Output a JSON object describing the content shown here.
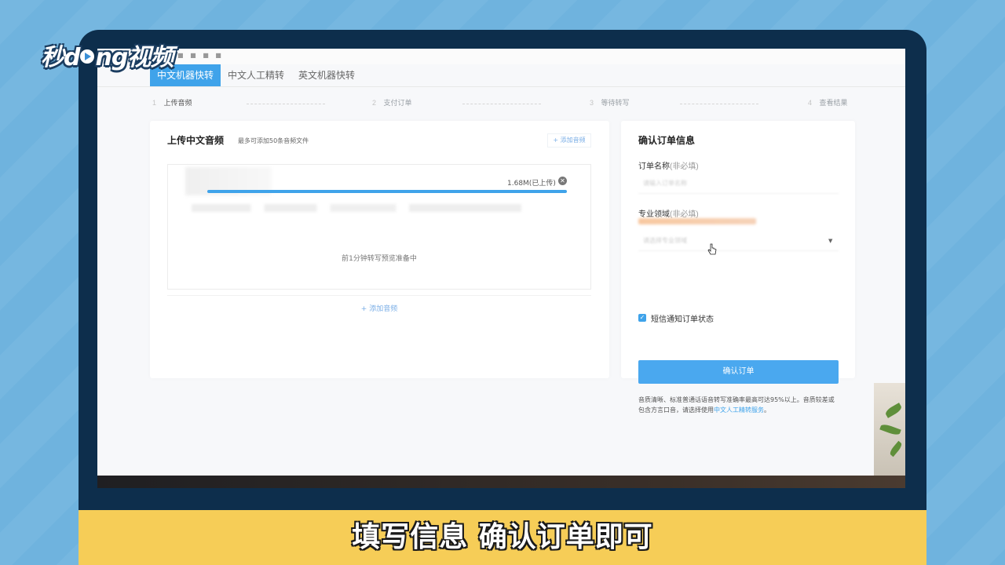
{
  "logo": {
    "left": "秒d",
    "right": "ng视频"
  },
  "tabs": [
    {
      "label": "中文机器快转",
      "active": true
    },
    {
      "label": "中文人工精转",
      "active": false
    },
    {
      "label": "英文机器快转",
      "active": false
    }
  ],
  "steps": [
    {
      "num": "1",
      "label": "上传音频",
      "active": true
    },
    {
      "num": "2",
      "label": "支付订单",
      "active": false
    },
    {
      "num": "3",
      "label": "等待转写",
      "active": false
    },
    {
      "num": "4",
      "label": "查看结果",
      "active": false
    }
  ],
  "upload": {
    "title": "上传中文音频",
    "note": "最多可添加50条音频文件",
    "add_top_label": "+ 添加音频",
    "file_size": "1.68M(已上传)",
    "progress_fraction": 1.0,
    "preview_text": "前1分钟转写预览准备中",
    "add_bottom_label": "+ 添加音频"
  },
  "order": {
    "title": "确认订单信息",
    "name_label": "订单名称",
    "name_optional": "(非必填)",
    "name_placeholder": "请输入订单名称",
    "domain_label": "专业领域",
    "domain_optional": "(非必填)",
    "domain_placeholder": "请选择专业领域",
    "sms_label": "短信通知订单状态",
    "sms_checked": true,
    "confirm_label": "确认订单",
    "foot_note_prefix": "音质清晰、标准普通话语音转写准确率最高可达95%以上。音质较差或包含方言口音，请选择使用",
    "foot_note_link": "中文人工精转服务",
    "foot_note_suffix": "。"
  },
  "caption": "填写信息  确认订单即可",
  "colors": {
    "accent": "#3fa3ea",
    "caption_bar": "#f6cd57",
    "frame": "#0d2e4c"
  }
}
